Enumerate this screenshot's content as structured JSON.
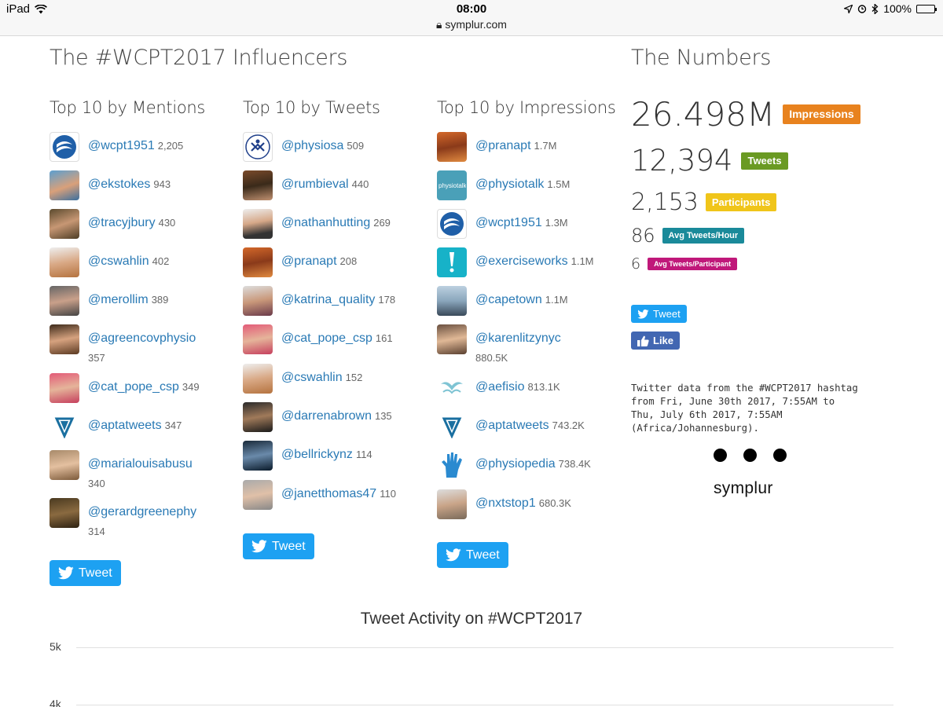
{
  "status": {
    "device": "iPad",
    "time": "08:00",
    "url": "symplur.com",
    "battery": "100%"
  },
  "influencers": {
    "title": "The #WCPT2017 Influencers",
    "mentions": {
      "title": "Top 10 by Mentions",
      "items": [
        {
          "handle": "@wcpt1951",
          "count": "2,205"
        },
        {
          "handle": "@ekstokes",
          "count": "943"
        },
        {
          "handle": "@tracyjbury",
          "count": "430"
        },
        {
          "handle": "@cswahlin",
          "count": "402"
        },
        {
          "handle": "@merollim",
          "count": "389"
        },
        {
          "handle": "@agreencovphysio",
          "count": "357"
        },
        {
          "handle": "@cat_pope_csp",
          "count": "349"
        },
        {
          "handle": "@aptatweets",
          "count": "347"
        },
        {
          "handle": "@marialouisabusu",
          "count": "340"
        },
        {
          "handle": "@gerardgreenephy",
          "count": "314"
        }
      ],
      "tweet_label": "Tweet"
    },
    "tweets": {
      "title": "Top 10 by Tweets",
      "items": [
        {
          "handle": "@physiosa",
          "count": "509"
        },
        {
          "handle": "@rumbieval",
          "count": "440"
        },
        {
          "handle": "@nathanhutting",
          "count": "269"
        },
        {
          "handle": "@pranapt",
          "count": "208"
        },
        {
          "handle": "@katrina_quality",
          "count": "178"
        },
        {
          "handle": "@cat_pope_csp",
          "count": "161"
        },
        {
          "handle": "@cswahlin",
          "count": "152"
        },
        {
          "handle": "@darrenabrown",
          "count": "135"
        },
        {
          "handle": "@bellrickynz",
          "count": "114"
        },
        {
          "handle": "@janetthomas47",
          "count": "110"
        }
      ],
      "tweet_label": "Tweet"
    },
    "impressions": {
      "title": "Top 10 by Impressions",
      "items": [
        {
          "handle": "@pranapt",
          "count": "1.7M"
        },
        {
          "handle": "@physiotalk",
          "count": "1.5M"
        },
        {
          "handle": "@wcpt1951",
          "count": "1.3M"
        },
        {
          "handle": "@exerciseworks",
          "count": "1.1M"
        },
        {
          "handle": "@capetown",
          "count": "1.1M"
        },
        {
          "handle": "@karenlitzynyc",
          "count": "880.5K"
        },
        {
          "handle": "@aefisio",
          "count": "813.1K"
        },
        {
          "handle": "@aptatweets",
          "count": "743.2K"
        },
        {
          "handle": "@physiopedia",
          "count": "738.4K"
        },
        {
          "handle": "@nxtstop1",
          "count": "680.3K"
        }
      ],
      "tweet_label": "Tweet"
    }
  },
  "numbers": {
    "title": "The Numbers",
    "impressions": {
      "value": "26.498M",
      "label": "Impressions",
      "color": "#e8821e"
    },
    "tweets": {
      "value": "12,394",
      "label": "Tweets",
      "color": "#6a9a23"
    },
    "participants": {
      "value": "2,153",
      "label": "Participants",
      "color": "#f0c51a"
    },
    "avg_hour": {
      "value": "86",
      "label": "Avg Tweets/Hour",
      "color": "#1a8a9a"
    },
    "avg_participant": {
      "value": "6",
      "label": "Avg Tweets/Participant",
      "color": "#c0187a"
    },
    "tweet_label": "Tweet",
    "like_label": "Like",
    "footnote": "Twitter data from the #WCPT2017 hashtag from Fri, June 30th 2017, 7:55AM to Thu, July 6th 2017, 7:55AM (Africa/Johannesburg).",
    "brand": "symplur"
  },
  "chart": {
    "title": "Tweet Activity on #WCPT2017",
    "y_labels": [
      "5k",
      "4k"
    ]
  },
  "colors": {
    "link": "#2a7ab5",
    "twitter": "#1da1f2",
    "facebook": "#4267b2"
  }
}
